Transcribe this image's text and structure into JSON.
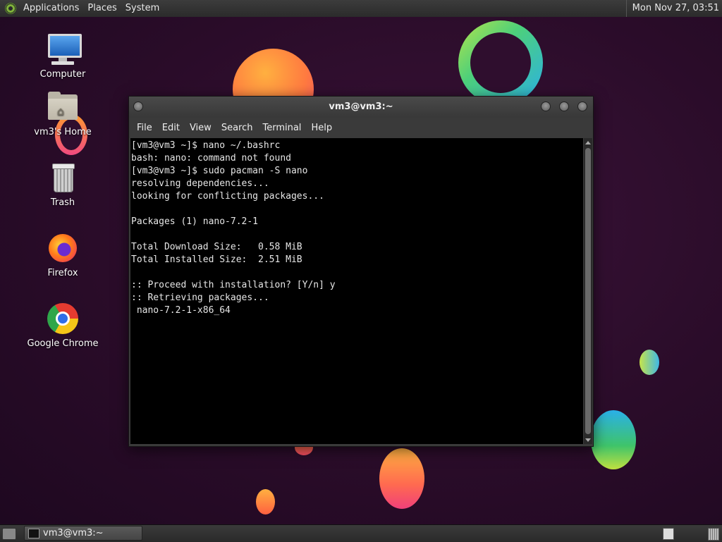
{
  "top_panel": {
    "applications": "Applications",
    "places": "Places",
    "system": "System",
    "clock": "Mon Nov 27, 03:51"
  },
  "desktop_icons": [
    {
      "label": "Computer",
      "icon": "computer-icon"
    },
    {
      "label": "vm3's Home",
      "icon": "home-folder-icon"
    },
    {
      "label": "Trash",
      "icon": "trash-icon"
    },
    {
      "label": "Firefox",
      "icon": "firefox-icon"
    },
    {
      "label": "Google Chrome",
      "icon": "chrome-icon"
    }
  ],
  "terminal": {
    "title": "vm3@vm3:~",
    "menu": [
      "File",
      "Edit",
      "View",
      "Search",
      "Terminal",
      "Help"
    ],
    "lines": [
      "[vm3@vm3 ~]$ nano ~/.bashrc",
      "bash: nano: command not found",
      "[vm3@vm3 ~]$ sudo pacman -S nano",
      "resolving dependencies...",
      "looking for conflicting packages...",
      "",
      "Packages (1) nano-7.2-1",
      "",
      "Total Download Size:   0.58 MiB",
      "Total Installed Size:  2.51 MiB",
      "",
      ":: Proceed with installation? [Y/n] y",
      ":: Retrieving packages...",
      " nano-7.2-1-x86_64"
    ]
  },
  "bottom_panel": {
    "task_title": "vm3@vm3:~"
  }
}
